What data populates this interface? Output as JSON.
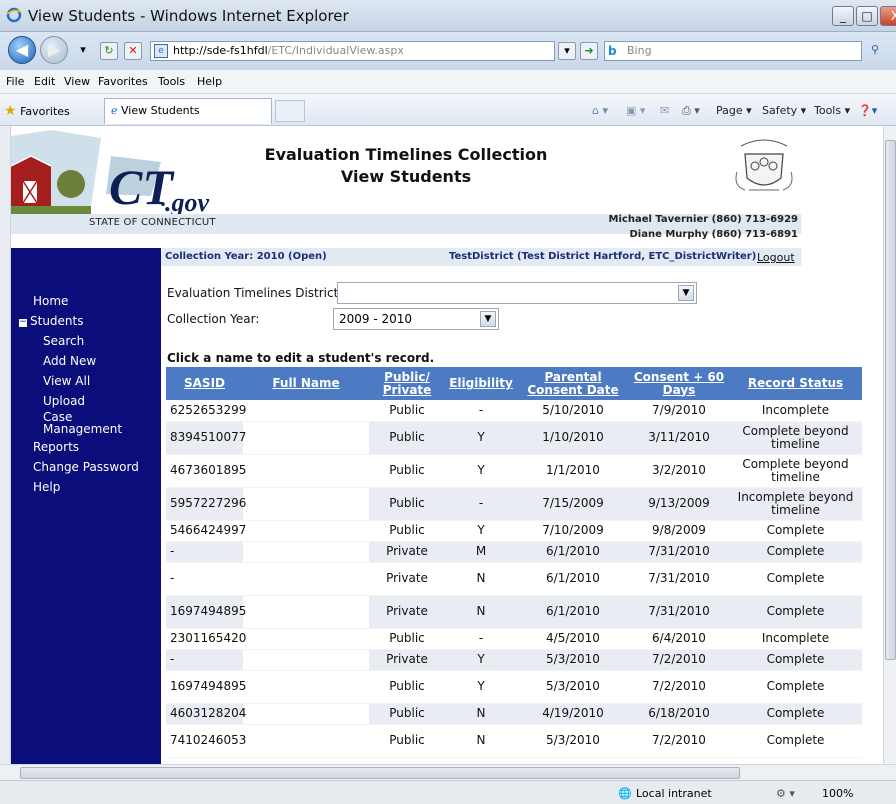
{
  "window": {
    "title": "View Students - Windows Internet Explorer",
    "min_label": "_",
    "max_label": "□",
    "close_label": "X"
  },
  "address": {
    "host": "http://sde-fs1hfdl",
    "path": "/ETC/IndividualView.aspx",
    "search_placeholder": "Bing"
  },
  "menu": [
    "File",
    "Edit",
    "View",
    "Favorites",
    "Tools",
    "Help"
  ],
  "favorites": {
    "label": "Favorites",
    "tab_title": "View Students"
  },
  "commands": [
    "Page ▾",
    "Safety ▾",
    "Tools ▾"
  ],
  "header": {
    "title_line1": "Evaluation Timelines Collection",
    "title_line2": "View Students",
    "state_label": "STATE OF CONNECTICUT",
    "contact1": "Michael Tavernier (860) 713-6929",
    "contact2": "Diane Murphy (860) 713-6891",
    "logo_text": "CT",
    "logo_suffix": ".gov"
  },
  "infobar": {
    "collection_year": "Collection Year: 2010 (Open)",
    "district": "TestDistrict (Test District Hartford, ETC_DistrictWriter)",
    "logout": "Logout"
  },
  "sidebar": {
    "items": [
      "Home",
      "Students",
      "Search",
      "Add New",
      "View All",
      "Upload",
      "Case",
      "Management",
      "Reports",
      "Change Password",
      "Help"
    ]
  },
  "form": {
    "district_label": "Evaluation Timelines District:",
    "district_value": "",
    "year_label": "Collection Year:",
    "year_value": "2009 - 2010"
  },
  "instruction": "Click a name to edit a student's record.",
  "table": {
    "headers": [
      "SASID",
      "Full Name",
      "Public/ Private",
      "Eligibility",
      "Parental Consent Date",
      "Consent + 60 Days",
      "Record Status"
    ],
    "rows": [
      [
        "6252653299",
        "",
        "Public",
        "-",
        "5/10/2010",
        "7/9/2010",
        "Incomplete"
      ],
      [
        "8394510077",
        "",
        "Public",
        "Y",
        "1/10/2010",
        "3/11/2010",
        "Complete beyond timeline"
      ],
      [
        "4673601895",
        "",
        "Public",
        "Y",
        "1/1/2010",
        "3/2/2010",
        "Complete beyond timeline"
      ],
      [
        "5957227296",
        "",
        "Public",
        "-",
        "7/15/2009",
        "9/13/2009",
        "Incomplete beyond timeline"
      ],
      [
        "5466424997",
        "",
        "Public",
        "Y",
        "7/10/2009",
        "9/8/2009",
        "Complete"
      ],
      [
        "-",
        "",
        "Private",
        "M",
        "6/1/2010",
        "7/31/2010",
        "Complete"
      ],
      [
        "-",
        "",
        "Private",
        "N",
        "6/1/2010",
        "7/31/2010",
        "Complete"
      ],
      [
        "1697494895",
        "",
        "Private",
        "N",
        "6/1/2010",
        "7/31/2010",
        "Complete"
      ],
      [
        "2301165420",
        "",
        "Public",
        "-",
        "4/5/2010",
        "6/4/2010",
        "Incomplete"
      ],
      [
        "-",
        "",
        "Private",
        "Y",
        "5/3/2010",
        "7/2/2010",
        "Complete"
      ],
      [
        "1697494895",
        "",
        "Public",
        "Y",
        "5/3/2010",
        "7/2/2010",
        "Complete"
      ],
      [
        "4603128204",
        "",
        "Public",
        "N",
        "4/19/2010",
        "6/18/2010",
        "Complete"
      ],
      [
        "7410246053",
        "",
        "Public",
        "N",
        "5/3/2010",
        "7/2/2010",
        "Complete"
      ]
    ]
  },
  "status": {
    "zone": "Local intranet",
    "zoom": "100%"
  },
  "colors": {
    "sidebar": "#0a0d7a",
    "table_header": "#4d7bc3",
    "row_alt": "#e9edf3",
    "info_text": "#1a2f7a"
  }
}
